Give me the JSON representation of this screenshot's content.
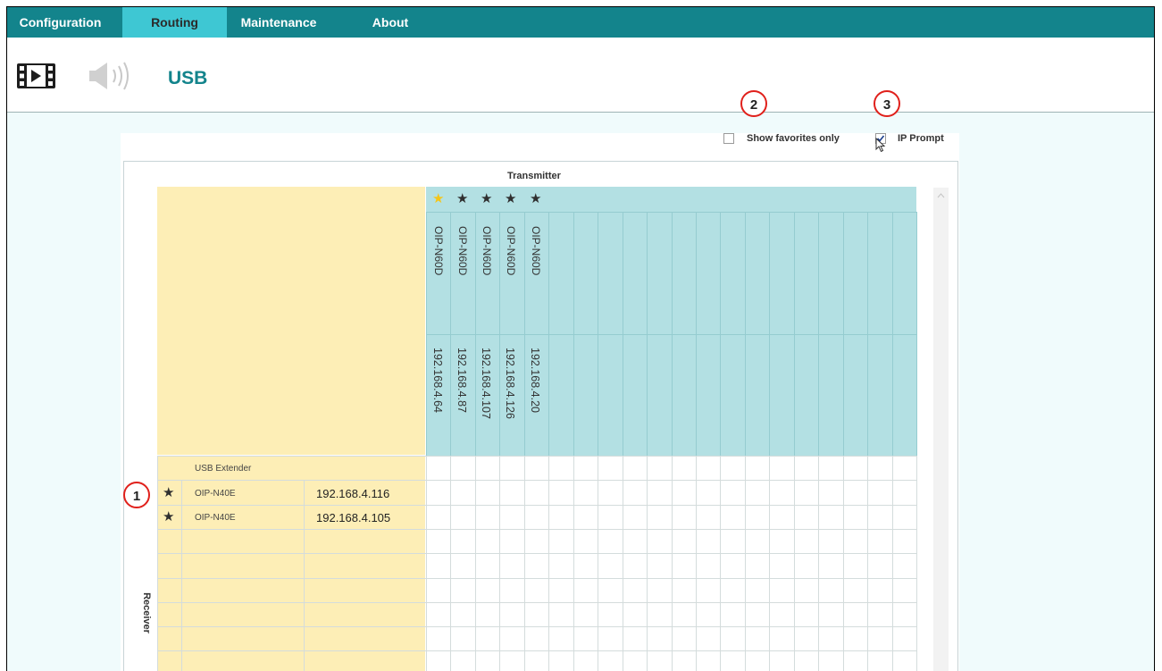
{
  "nav": {
    "items": [
      {
        "label": "Configuration",
        "active": false
      },
      {
        "label": "Routing",
        "active": true
      },
      {
        "label": "Maintenance",
        "active": false
      },
      {
        "label": "About",
        "active": false
      }
    ]
  },
  "header": {
    "icons": [
      "video-icon",
      "speaker-icon"
    ],
    "title": "USB"
  },
  "options": {
    "show_favorites_label": "Show favorites only",
    "show_favorites_checked": false,
    "ip_prompt_label": "IP Prompt",
    "ip_prompt_checked": true
  },
  "callouts": [
    "1",
    "2",
    "3"
  ],
  "matrix": {
    "transmitter_label": "Transmitter",
    "receiver_label": "Receiver",
    "group_label": "USB Extender",
    "transmitters": [
      {
        "name": "OIP-N60D",
        "ip": "192.168.4.64",
        "favorite": true
      },
      {
        "name": "OIP-N60D",
        "ip": "192.168.4.87",
        "favorite": false
      },
      {
        "name": "OIP-N60D",
        "ip": "192.168.4.107",
        "favorite": false
      },
      {
        "name": "OIP-N60D",
        "ip": "192.168.4.126",
        "favorite": false
      },
      {
        "name": "OIP-N60D",
        "ip": "192.168.4.20",
        "favorite": false
      }
    ],
    "receivers": [
      {
        "name": "OIP-N40E",
        "ip": "192.168.4.116"
      },
      {
        "name": "OIP-N40E",
        "ip": "192.168.4.105"
      }
    ]
  },
  "colors": {
    "nav_bg": "#13848c",
    "nav_active": "#3ec7d3",
    "title": "#13848c",
    "transmitter_header": "#b3e0e3",
    "receiver_header": "#fdeeb6",
    "callout": "#e0201b",
    "favorite_star": "#f5c518"
  }
}
